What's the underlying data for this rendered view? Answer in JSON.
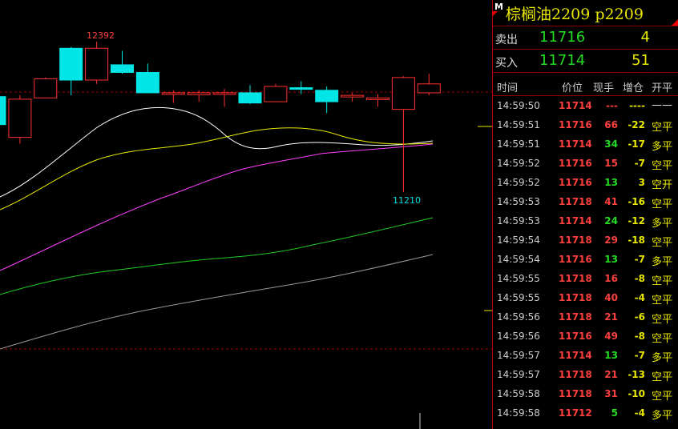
{
  "header": {
    "badge": "M",
    "title": "棕榈油2209  p2209"
  },
  "quotes": [
    {
      "label": "卖出",
      "price": "11716",
      "volume": "4"
    },
    {
      "label": "买入",
      "price": "11714",
      "volume": "51"
    }
  ],
  "ticks_header": [
    "时间",
    "价位",
    "现手",
    "增仓",
    "开平"
  ],
  "ticks": [
    {
      "time": "14:59:50",
      "price": "11714",
      "hand": "---",
      "chg": "----",
      "type": "——",
      "type_color": "white",
      "price_color": "red",
      "hand_color": "red",
      "chg_color": "yellow"
    },
    {
      "time": "14:59:51",
      "price": "11716",
      "hand": "66",
      "chg": "-22",
      "type": "空平",
      "type_color": "yellow",
      "price_color": "red",
      "hand_color": "red",
      "chg_color": "yellow"
    },
    {
      "time": "14:59:51",
      "price": "11714",
      "hand": "34",
      "chg": "-17",
      "type": "多平",
      "type_color": "yellow",
      "price_color": "red",
      "hand_color": "green",
      "chg_color": "yellow"
    },
    {
      "time": "14:59:52",
      "price": "11716",
      "hand": "15",
      "chg": "-7",
      "type": "空平",
      "type_color": "yellow",
      "price_color": "red",
      "hand_color": "red",
      "chg_color": "yellow"
    },
    {
      "time": "14:59:52",
      "price": "11716",
      "hand": "13",
      "chg": "3",
      "type": "空开",
      "type_color": "yellow",
      "price_color": "red",
      "hand_color": "green",
      "chg_color": "yellow"
    },
    {
      "time": "14:59:53",
      "price": "11718",
      "hand": "41",
      "chg": "-16",
      "type": "空平",
      "type_color": "yellow",
      "price_color": "red",
      "hand_color": "red",
      "chg_color": "yellow"
    },
    {
      "time": "14:59:53",
      "price": "11714",
      "hand": "24",
      "chg": "-12",
      "type": "多平",
      "type_color": "yellow",
      "price_color": "red",
      "hand_color": "green",
      "chg_color": "yellow"
    },
    {
      "time": "14:59:54",
      "price": "11718",
      "hand": "29",
      "chg": "-18",
      "type": "空平",
      "type_color": "yellow",
      "price_color": "red",
      "hand_color": "red",
      "chg_color": "yellow"
    },
    {
      "time": "14:59:54",
      "price": "11716",
      "hand": "13",
      "chg": "-7",
      "type": "多平",
      "type_color": "yellow",
      "price_color": "red",
      "hand_color": "green",
      "chg_color": "yellow"
    },
    {
      "time": "14:59:55",
      "price": "11718",
      "hand": "16",
      "chg": "-8",
      "type": "空平",
      "type_color": "yellow",
      "price_color": "red",
      "hand_color": "red",
      "chg_color": "yellow"
    },
    {
      "time": "14:59:55",
      "price": "11718",
      "hand": "40",
      "chg": "-4",
      "type": "空平",
      "type_color": "yellow",
      "price_color": "red",
      "hand_color": "red",
      "chg_color": "yellow"
    },
    {
      "time": "14:59:56",
      "price": "11718",
      "hand": "21",
      "chg": "-6",
      "type": "空平",
      "type_color": "yellow",
      "price_color": "red",
      "hand_color": "red",
      "chg_color": "yellow"
    },
    {
      "time": "14:59:56",
      "price": "11716",
      "hand": "49",
      "chg": "-8",
      "type": "空平",
      "type_color": "yellow",
      "price_color": "red",
      "hand_color": "red",
      "chg_color": "yellow"
    },
    {
      "time": "14:59:57",
      "price": "11714",
      "hand": "13",
      "chg": "-7",
      "type": "多平",
      "type_color": "yellow",
      "price_color": "red",
      "hand_color": "green",
      "chg_color": "yellow"
    },
    {
      "time": "14:59:57",
      "price": "11718",
      "hand": "21",
      "chg": "-13",
      "type": "空平",
      "type_color": "yellow",
      "price_color": "red",
      "hand_color": "red",
      "chg_color": "yellow"
    },
    {
      "time": "14:59:58",
      "price": "11718",
      "hand": "31",
      "chg": "-10",
      "type": "空平",
      "type_color": "yellow",
      "price_color": "red",
      "hand_color": "red",
      "chg_color": "yellow"
    },
    {
      "time": "14:59:58",
      "price": "11712",
      "hand": "5",
      "chg": "-4",
      "type": "多平",
      "type_color": "yellow",
      "price_color": "red",
      "hand_color": "green",
      "chg_color": "yellow"
    }
  ],
  "colors": {
    "up": "#ff3030",
    "down": "#00e5e5",
    "ma5": "#ffffff",
    "ma10": "#e8e800",
    "ma20": "#ff40ff",
    "ma40": "#22cc22",
    "ma60": "#999999",
    "dashed": "#a00000"
  },
  "chart_data": {
    "type": "candlestick",
    "annotations": {
      "high_label": "12392",
      "low_label": "11210"
    },
    "candles": [
      {
        "o": 11960,
        "c": 11740,
        "h": 11960,
        "l": 11740,
        "dir": "down"
      },
      {
        "o": 11640,
        "c": 11940,
        "h": 11970,
        "l": 11590,
        "dir": "up"
      },
      {
        "o": 11950,
        "c": 12100,
        "h": 12110,
        "l": 11950,
        "dir": "up"
      },
      {
        "o": 12340,
        "c": 12090,
        "h": 12350,
        "l": 11970,
        "dir": "down"
      },
      {
        "o": 12090,
        "c": 12340,
        "h": 12392,
        "l": 12060,
        "dir": "up"
      },
      {
        "o": 12210,
        "c": 12150,
        "h": 12320,
        "l": 12140,
        "dir": "down"
      },
      {
        "o": 12150,
        "c": 11990,
        "h": 12220,
        "l": 11990,
        "dir": "down"
      },
      {
        "o": 11990,
        "c": 11980,
        "h": 12010,
        "l": 11910,
        "dir": "up"
      },
      {
        "o": 11990,
        "c": 11975,
        "h": 12010,
        "l": 11920,
        "dir": "up"
      },
      {
        "o": 11980,
        "c": 11990,
        "h": 12020,
        "l": 11880,
        "dir": "up"
      },
      {
        "o": 11990,
        "c": 11910,
        "h": 12050,
        "l": 11900,
        "dir": "down"
      },
      {
        "o": 11920,
        "c": 12040,
        "h": 12060,
        "l": 11920,
        "dir": "up"
      },
      {
        "o": 12030,
        "c": 12020,
        "h": 12080,
        "l": 11980,
        "dir": "down"
      },
      {
        "o": 12010,
        "c": 11920,
        "h": 12040,
        "l": 11830,
        "dir": "down"
      },
      {
        "o": 11970,
        "c": 11960,
        "h": 11990,
        "l": 11920,
        "dir": "up"
      },
      {
        "o": 11950,
        "c": 11945,
        "h": 11980,
        "l": 11880,
        "dir": "up"
      },
      {
        "o": 11860,
        "c": 12110,
        "h": 12120,
        "l": 11210,
        "dir": "up"
      },
      {
        "o": 11990,
        "c": 12060,
        "h": 12140,
        "l": 11970,
        "dir": "up"
      }
    ]
  }
}
